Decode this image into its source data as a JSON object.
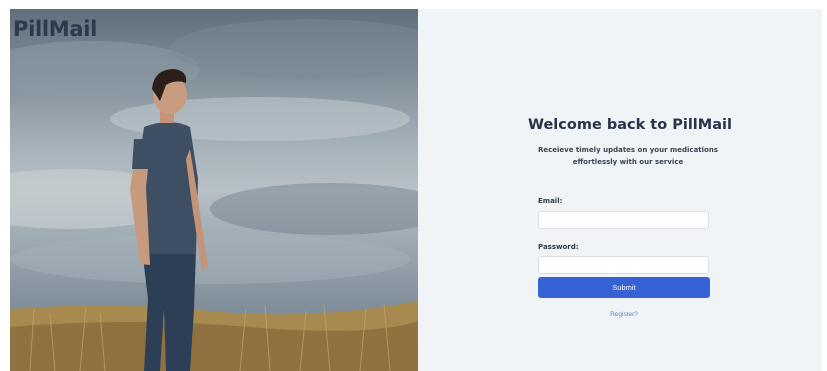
{
  "brand": {
    "name": "PillMail"
  },
  "hero": {
    "image": "man-standing-in-field-photo",
    "colors": {
      "sky": "#9aa7b0",
      "grass": "#a8894f",
      "shirt": "#3e4f63",
      "jeans": "#2c3f57"
    }
  },
  "login": {
    "title": "Welcome back to PillMail",
    "subtitle_line1": "Receieve timely updates on your medications",
    "subtitle_line2": "effortlessly with our service",
    "email_label": "Email:",
    "email_value": "",
    "password_label": "Password:",
    "password_value": "",
    "submit_label": "Submit",
    "register_link": "Register?"
  },
  "theme": {
    "panel_bg": "#f0f4f6",
    "accent": "#3662d5",
    "link": "#5a86cf",
    "heading": "#27344a"
  }
}
